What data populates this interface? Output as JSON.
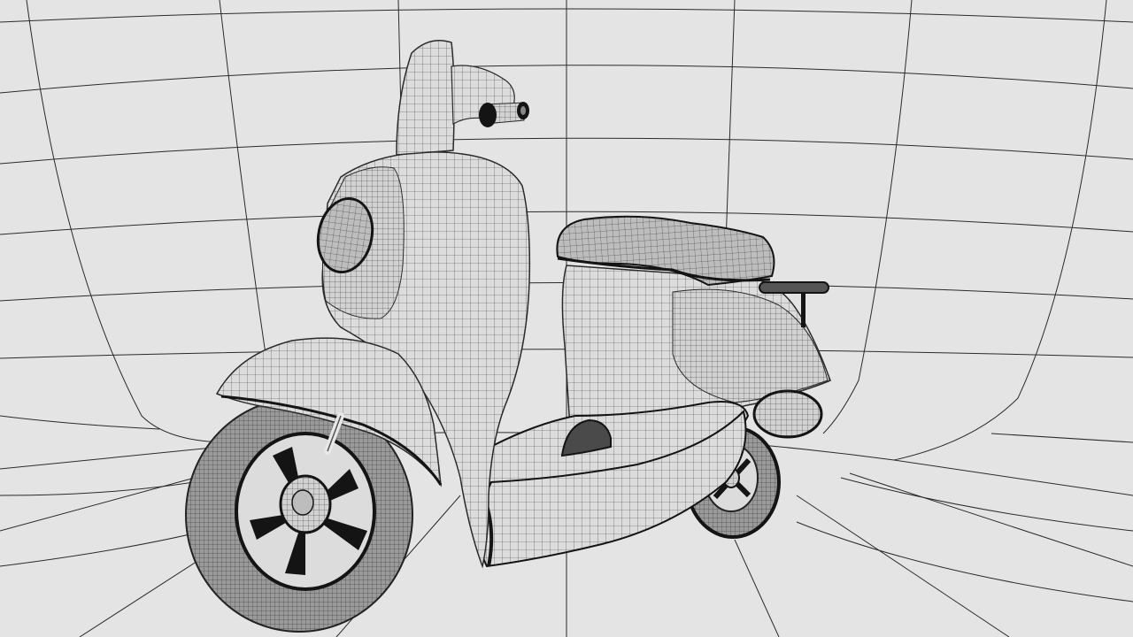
{
  "scene": {
    "subject": "scooter-wireframe-render",
    "background_color": "#e4e4e4",
    "grid_color": "#2a2a2a",
    "surface_color": "#dadada",
    "mesh_color": "#3a3a3a",
    "tire_color": "#8c8c8c",
    "accent_color": "#141414"
  }
}
